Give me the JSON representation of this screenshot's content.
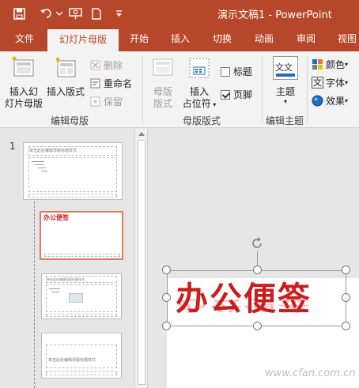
{
  "title_bar": {
    "document_title": "演示文稿1 - PowerPoint",
    "qat_icons": [
      "save-icon",
      "undo-icon",
      "undo-dropdown-icon",
      "present-from-start-icon",
      "new-file-icon",
      "customize-qat-icon"
    ],
    "colors": {
      "accent": "#b7472a",
      "ribbon_bg": "#f3f3f3"
    }
  },
  "tabs": [
    {
      "label": "文件"
    },
    {
      "label": "幻灯片母版"
    },
    {
      "label": "开始"
    },
    {
      "label": "插入"
    },
    {
      "label": "切换"
    },
    {
      "label": "动画"
    },
    {
      "label": "审阅"
    },
    {
      "label": "视图"
    }
  ],
  "active_tab": "幻灯片母版",
  "ribbon": {
    "edit_master": {
      "label": "编辑母版",
      "insert_slide_master": "插入幻灯片母版",
      "insert_slide_master_line1": "插入幻",
      "insert_slide_master_line2": "灯片母版",
      "insert_layout": "插入版式",
      "delete": "删除",
      "rename": "重命名",
      "preserve": "保留"
    },
    "master_layout": {
      "label": "母版版式",
      "master_layout_line1": "母版",
      "master_layout_line2": "版式",
      "insert_placeholder_line1": "插入",
      "insert_placeholder_line2": "占位符",
      "title_checkbox": "标题",
      "title_checked": false,
      "footer_checkbox": "页脚",
      "footer_checked": true
    },
    "edit_theme": {
      "label": "编辑主题",
      "themes": "主题",
      "theme_icon_text": "文文"
    },
    "background": {
      "colors": "颜色",
      "fonts": "字体",
      "effects": "效果"
    }
  },
  "thumbnails": {
    "slide_number": "1",
    "master_title": "单击此处编辑母版标题样式",
    "layout2_title": "办公便签",
    "layout4_title": "单击此处编辑母版标题样式"
  },
  "slide": {
    "wordart_text": "办公便签",
    "wordart_color": "#c81e1e"
  },
  "watermark": "www.cfan.com.cn"
}
